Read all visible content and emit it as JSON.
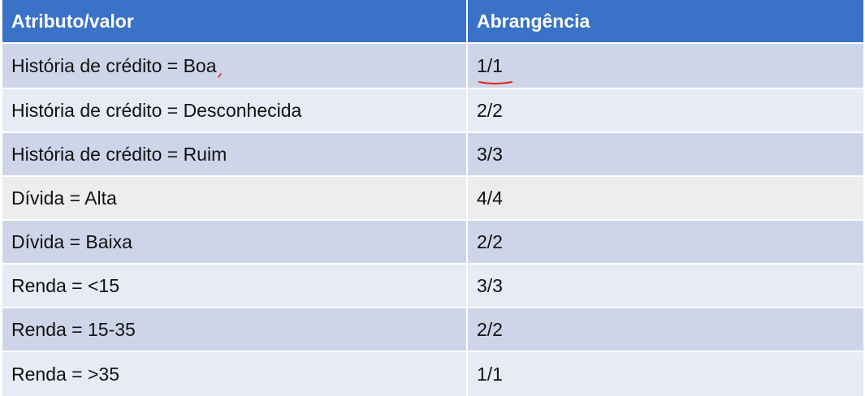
{
  "table": {
    "headers": [
      "Atributo/valor",
      "Abrangência"
    ],
    "rows": [
      [
        "História de crédito = Boa",
        "1/1"
      ],
      [
        "História de crédito = Desconhecida",
        "2/2"
      ],
      [
        "História de crédito = Ruim",
        "3/3"
      ],
      [
        "Dívida = Alta",
        "4/4"
      ],
      [
        "Dívida = Baixa",
        "2/2"
      ],
      [
        "Renda = <15",
        "3/3"
      ],
      [
        "Renda = 15-35",
        "2/2"
      ],
      [
        "Renda = >35",
        "1/1"
      ]
    ]
  },
  "colors": {
    "header_bg": "#3a72c7",
    "row_dark": "#cfd5e9",
    "row_light": "#e8ebf5",
    "row_highlight": "#ededed",
    "annotation": "#e0201a"
  }
}
